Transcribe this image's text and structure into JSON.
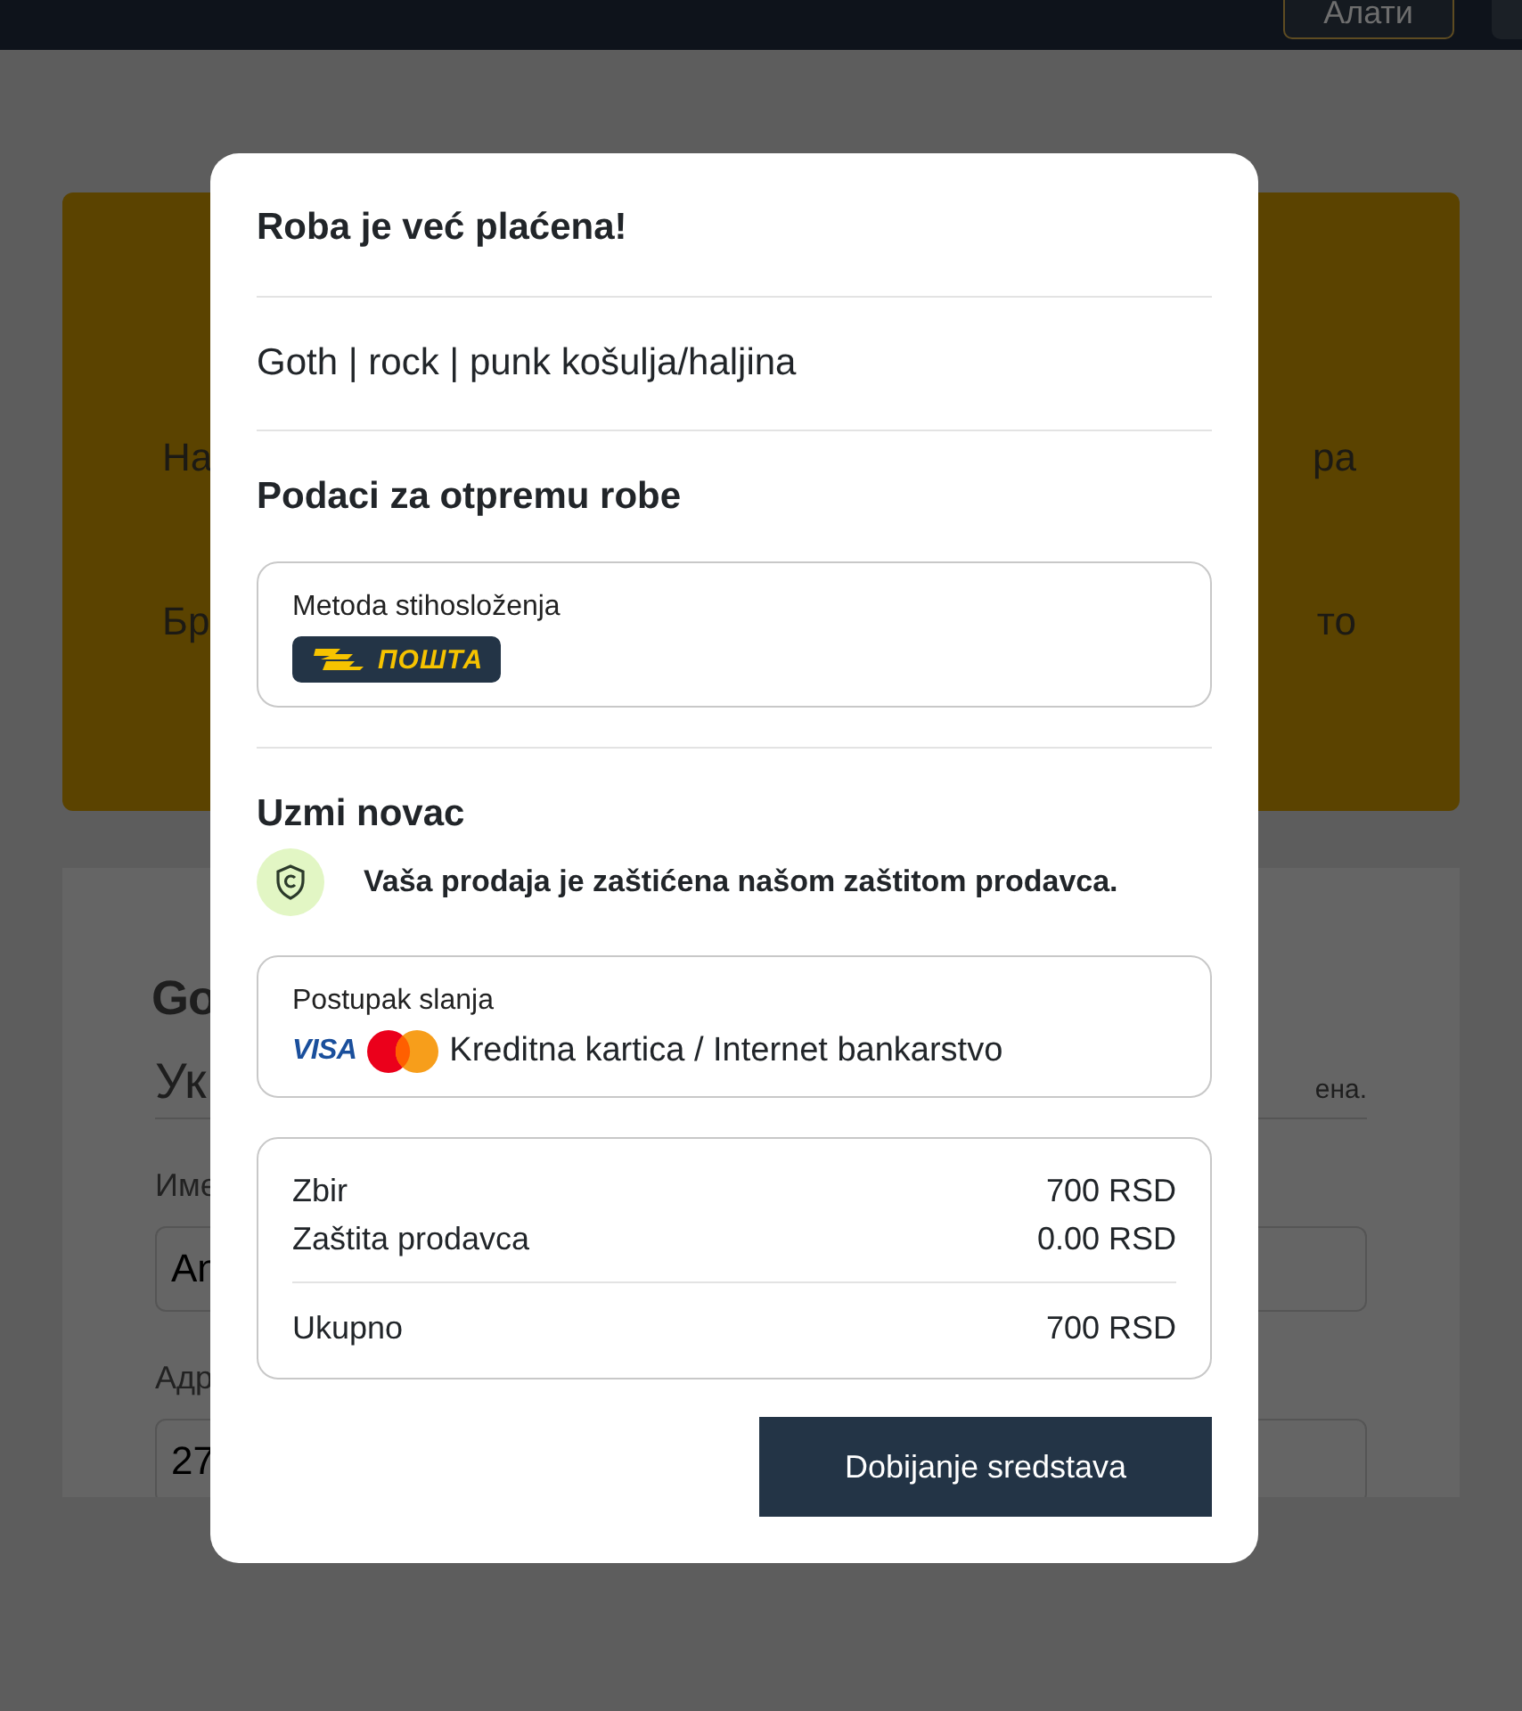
{
  "header": {
    "buttons": [
      "Алати"
    ]
  },
  "background": {
    "banner_lines": [
      {
        "left": "На",
        "right": "ра"
      },
      {
        "left": "Бр",
        "right": "то"
      }
    ],
    "form": {
      "title": "Go",
      "subtitle": "Ук",
      "note": "ена.",
      "fields": [
        {
          "label": "Име",
          "value": "An"
        },
        {
          "label": "Адр",
          "value": "27"
        }
      ]
    }
  },
  "dialog": {
    "title": "Roba je već plaćena!",
    "product": "Goth | rock | punk košulja/haljina",
    "shipping": {
      "heading": "Podaci za otpremu robe",
      "label": "Metoda stihosloženja",
      "carrier_logo": "ПОШТА"
    },
    "payout": {
      "heading": "Uzmi novac",
      "protection": "Vaša prodaja je zaštićena našom zaštitom prodavca.",
      "label": "Postupak slanja",
      "card_brand": "VISA",
      "method": "Kreditna kartica / Internet bankarstvo"
    },
    "summary": [
      {
        "label": "Zbir",
        "value": "700 RSD"
      },
      {
        "label": "Zaštita prodavca",
        "value": "0.00 RSD"
      }
    ],
    "total": {
      "label": "Ukupno",
      "value": "700 RSD"
    },
    "button": "Dobijanje sredstava"
  }
}
